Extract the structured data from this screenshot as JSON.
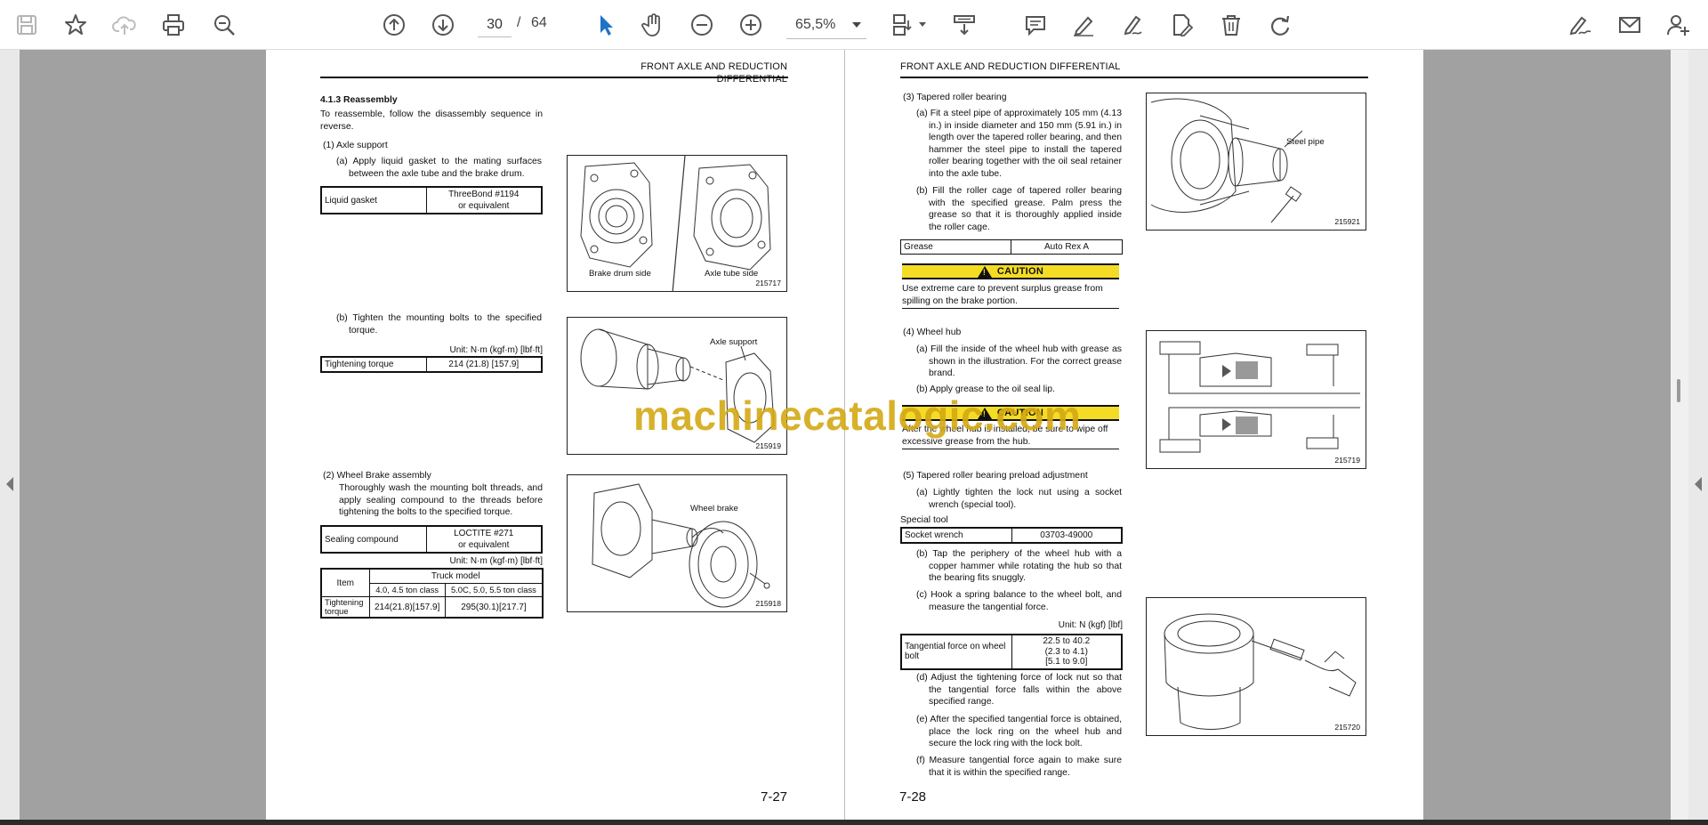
{
  "toolbar": {
    "current_page": "30",
    "page_sep": "/",
    "total_pages": "64",
    "zoom": "65,5%",
    "icons": [
      "save-icon",
      "bookmark-star-icon",
      "cloud-upload-icon",
      "print-icon",
      "zoom-search-icon",
      "page-up-icon",
      "page-down-icon",
      "select-arrow-icon",
      "hand-icon",
      "zoom-out-icon",
      "zoom-in-icon",
      "page-layout-icon",
      "scroll-mode-icon",
      "comment-icon",
      "highlight-pen-icon",
      "draw-pen-icon",
      "edit-document-icon",
      "delete-icon",
      "redo-icon",
      "sign-icon",
      "email-icon",
      "add-user-icon"
    ]
  },
  "colors": {
    "viewer_bg": "#a1a1a1",
    "caution_yellow": "#f5dc24",
    "watermark": "#d4a915",
    "accent_blue": "#1e73c8"
  },
  "watermark": "machinecatalogic.com",
  "left_page": {
    "header": "FRONT AXLE AND REDUCTION DIFFERENTIAL",
    "section_title": "4.1.3   Reassembly",
    "intro": "To reassemble, follow the disassembly sequence in reverse.",
    "s1_title": "(1)  Axle support",
    "s1a": "(a) Apply liquid gasket to the mating surfaces between the axle tube and the brake drum.",
    "t1": {
      "label": "Liquid gasket",
      "value1": "ThreeBond #1194",
      "value2": "or equivalent"
    },
    "s1b": "(b) Tighten the mounting bolts to the specified torque.",
    "unit1": "Unit: N·m (kgf·m) [lbf·ft]",
    "t2": {
      "label": "Tightening torque",
      "value": "214 (21.8) [157.9]"
    },
    "s2_title": "(2)  Wheel Brake assembly",
    "s2_text": "Thoroughly wash the mounting bolt threads, and apply sealing compound to the threads before tightening the bolts to the specified torque.",
    "t3": {
      "label": "Sealing compound",
      "value1": "LOCTITE #271",
      "value2": "or equivalent"
    },
    "unit2": "Unit: N·m (kgf·m) [lbf·ft]",
    "t4": {
      "item": "Item",
      "truck_model": "Truck model",
      "col1": "4.0, 4.5 ton class",
      "col2": "5.0C, 5.0, 5.5 ton class",
      "row_label": "Tightening torque",
      "v1": "214(21.8)[157.9]",
      "v2": "295(30.1)[217.7]"
    },
    "fig1": {
      "cap_left": "Brake drum side",
      "cap_right": "Axle tube side",
      "num": "215717"
    },
    "fig2": {
      "label": "Axle support",
      "num": "215919"
    },
    "fig3": {
      "label": "Wheel brake",
      "num": "215918"
    },
    "page_number": "7-27"
  },
  "right_page": {
    "header": "FRONT AXLE AND REDUCTION DIFFERENTIAL",
    "s3_title": "(3)  Tapered roller bearing",
    "s3a": "(a) Fit a steel pipe of approximately 105 mm (4.13 in.) in inside diameter and 150 mm (5.91 in.) in length over the tapered roller bearing, and then hammer the steel pipe to install the tapered roller bearing together with the oil seal retainer into the axle tube.",
    "s3b": "(b) Fill the roller cage of tapered roller bearing with the specified grease. Palm press the grease so that it is thoroughly applied inside the roller cage.",
    "t5": {
      "label": "Grease",
      "value": "Auto Rex A"
    },
    "caution1_title": "CAUTION",
    "caution1_text": "Use extreme care to prevent surplus grease from spilling on the brake portion.",
    "s4_title": "(4)  Wheel hub",
    "s4a": "(a) Fill the inside of the wheel hub with grease as shown in the illustration. For the correct grease brand.",
    "s4b": "(b) Apply grease to the oil seal lip.",
    "caution2_title": "CAUTION",
    "caution2_text": "After the wheel hub is installed, be sure to wipe off excessive grease from the hub.",
    "s5_title": "(5)  Tapered roller bearing preload adjustment",
    "s5a": "(a) Lightly tighten the lock nut using a socket wrench (special tool).",
    "special_tool": "Special tool",
    "t6": {
      "label": "Socket wrench",
      "value": "03703-49000"
    },
    "s5b": "(b) Tap the periphery of the wheel hub with a copper hammer while rotating the hub so that the bearing fits snuggly.",
    "s5c": "(c) Hook a spring balance to the wheel bolt, and measure the tangential force.",
    "unit3": "Unit: N (kgf) [lbf]",
    "t7": {
      "label": "Tangential force on wheel bolt",
      "v1": "22.5 to 40.2",
      "v2": "(2.3 to 4.1)",
      "v3": "[5.1 to 9.0]"
    },
    "s5d": "(d) Adjust the tightening force of lock nut so that the tangential force falls within the above specified range.",
    "s5e": "(e) After the specified tangential force is obtained, place the lock ring on the wheel hub and secure the lock ring with the lock bolt.",
    "s5f": "(f) Measure tangential force again to make sure that it is within the specified range.",
    "fig4": {
      "label": "Steel pipe",
      "num": "215921"
    },
    "fig5": {
      "num": "215719"
    },
    "fig6": {
      "num": "215720"
    },
    "page_number": "7-28"
  }
}
